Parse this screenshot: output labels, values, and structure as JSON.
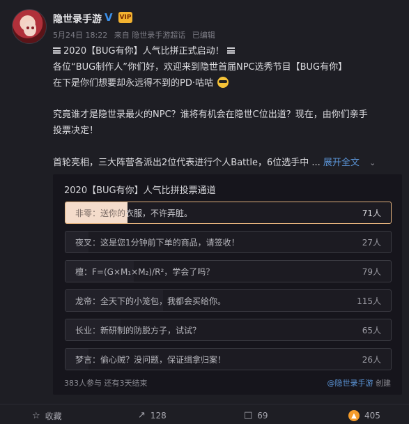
{
  "header": {
    "username": "隐世录手游",
    "verified_mark": "V",
    "vip_badge": "VIP",
    "date": "5月24日 18:22",
    "source": "来自 隐世录手游超话",
    "edited": "已编辑"
  },
  "post": {
    "line1": "2020【BUG有你】人气比拼正式启动！",
    "line2": "各位“BUG制作人”你们好，欢迎来到隐世首届NPC选秀节目【BUG有你】",
    "line3": "在下是你们想要却永远得不到的PD·咕咕",
    "line4": "究竟谁才是隐世录最火的NPC？谁将有机会在隐世C位出道？现在，由你们亲手",
    "line5": "投票决定！",
    "line6": "首轮亮相，三大阵营各派出2位代表进行个人Battle，6位选手中 ...",
    "expand_label": "展开全文",
    "expand_icon": "chevron-down-icon"
  },
  "poll": {
    "title": "2020【BUG有你】人气比拼投票通道",
    "options": [
      {
        "label_dark": "非零：送你的",
        "label_rest": "衣服，不许弄脏。",
        "count": "71人",
        "share": 0.19,
        "selected": true
      },
      {
        "label": "夜叉：这是您1分钟前下单的商品，请签收！",
        "count": "27人",
        "share": 0.07,
        "selected": false
      },
      {
        "label": "檀：F=(G×M₁×M₂)/R²，学会了吗？",
        "count": "79人",
        "share": 0.21,
        "selected": false
      },
      {
        "label": "龙帝：全天下的小笼包，我都会买给你。",
        "count": "115人",
        "share": 0.3,
        "selected": false
      },
      {
        "label": "长业：新研制的防脱方子，试试？",
        "count": "65人",
        "share": 0.17,
        "selected": false
      },
      {
        "label": "梦言：偷心贼？没问题，保证缉拿归案！",
        "count": "26人",
        "share": 0.07,
        "selected": false
      }
    ],
    "footer_left": "383人参与 还有3天结束",
    "footer_account": "@隐世录手游",
    "footer_created": "创建"
  },
  "actions": {
    "favorite_label": "收藏",
    "repost_count": "128",
    "comment_count": "69",
    "like_count": "405"
  },
  "colors": {
    "accent_link": "#5b94d6",
    "selected_border": "#e2b07c",
    "like_orange": "#f39b2b",
    "vip_gold": "#f2b230"
  }
}
